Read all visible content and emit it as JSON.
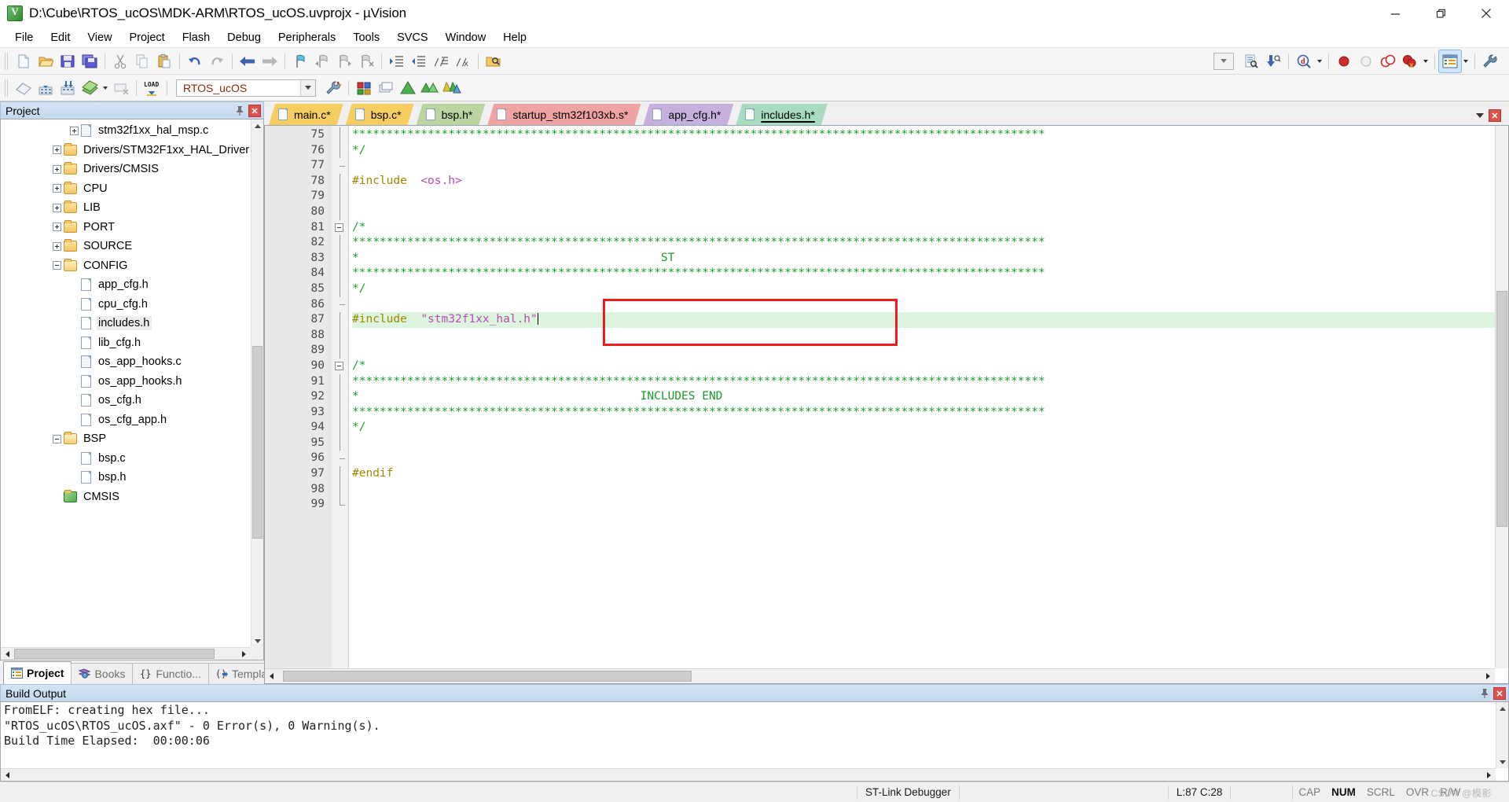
{
  "window": {
    "title": "D:\\Cube\\RTOS_ucOS\\MDK-ARM\\RTOS_ucOS.uvprojx - µVision",
    "icon": "uvision-logo",
    "minimize": "—",
    "restore": "❐",
    "close": "✕"
  },
  "menubar": {
    "items": [
      "File",
      "Edit",
      "View",
      "Project",
      "Flash",
      "Debug",
      "Peripherals",
      "Tools",
      "SVCS",
      "Window",
      "Help"
    ]
  },
  "toolbar_main": {
    "buttons": [
      {
        "name": "new-file-icon",
        "glyph": "🗋"
      },
      {
        "name": "open-file-icon",
        "glyph": "📂"
      },
      {
        "name": "save-icon",
        "glyph": "💾"
      },
      {
        "name": "save-all-icon",
        "glyph": "🖫"
      },
      {
        "name": "cut-icon",
        "glyph": "✂"
      },
      {
        "name": "copy-icon",
        "glyph": "❐"
      },
      {
        "name": "paste-icon",
        "glyph": "📋"
      },
      {
        "name": "undo-icon",
        "glyph": "↶"
      },
      {
        "name": "redo-icon",
        "glyph": "↷"
      },
      {
        "name": "navigate-back-icon",
        "glyph": "←"
      },
      {
        "name": "navigate-forward-icon",
        "glyph": "→"
      },
      {
        "name": "toggle-bookmark-icon",
        "glyph": "⚑"
      },
      {
        "name": "prev-bookmark-icon",
        "glyph": "⚑"
      },
      {
        "name": "next-bookmark-icon",
        "glyph": "⚑"
      },
      {
        "name": "clear-bookmarks-icon",
        "glyph": "⚑"
      },
      {
        "name": "indent-icon",
        "glyph": "⇥"
      },
      {
        "name": "outdent-icon",
        "glyph": "⇤"
      },
      {
        "name": "comment-icon",
        "glyph": "//"
      },
      {
        "name": "uncomment-icon",
        "glyph": "//"
      },
      {
        "name": "find-in-files-icon",
        "glyph": "🔍"
      }
    ],
    "search_combo_placeholder": "",
    "right_buttons": [
      {
        "name": "find-icon",
        "glyph": "🗂"
      },
      {
        "name": "incremental-find-icon",
        "glyph": "🔎"
      },
      {
        "name": "browse-symbol-icon",
        "glyph": "ⓘ"
      },
      {
        "name": "insert-breakpoint-icon",
        "glyph": "●"
      },
      {
        "name": "disable-breakpoint-icon",
        "glyph": "○"
      },
      {
        "name": "disable-all-breakpoints-icon",
        "glyph": "◌"
      },
      {
        "name": "kill-all-breakpoints-icon",
        "glyph": "✖"
      },
      {
        "name": "project-window-icon",
        "glyph": "▤"
      },
      {
        "name": "configuration-wizard-icon",
        "glyph": "🔧"
      }
    ]
  },
  "toolbar_build": {
    "buttons": [
      {
        "name": "translate-icon",
        "glyph": "▦"
      },
      {
        "name": "build-icon",
        "glyph": "▦"
      },
      {
        "name": "rebuild-icon",
        "glyph": "▦"
      },
      {
        "name": "batch-build-icon",
        "glyph": "▤"
      },
      {
        "name": "stop-build-icon",
        "glyph": "▧"
      },
      {
        "name": "download-icon",
        "glyph": "LOAD"
      }
    ],
    "project_target": "RTOS_ucOS",
    "right_buttons": [
      {
        "name": "target-options-icon",
        "glyph": "⚙"
      },
      {
        "name": "manage-project-items-icon",
        "glyph": "▩"
      },
      {
        "name": "manage-run-time-env-icon",
        "glyph": "◈"
      },
      {
        "name": "pack-installer-icon",
        "glyph": "◆"
      },
      {
        "name": "manage-components-icon",
        "glyph": "▲"
      }
    ]
  },
  "project_pane": {
    "title": "Project",
    "pin_icon": "pin-icon",
    "close_icon": "close-icon",
    "tree": [
      {
        "label": "stm32f1xx_hal_msp.c",
        "type": "file-src",
        "indent": 3,
        "expander": "plus",
        "selected": false
      },
      {
        "label": "Drivers/STM32F1xx_HAL_Driver",
        "type": "folder",
        "indent": 2,
        "expander": "plus",
        "selected": false
      },
      {
        "label": "Drivers/CMSIS",
        "type": "folder",
        "indent": 2,
        "expander": "plus",
        "selected": false
      },
      {
        "label": "CPU",
        "type": "folder",
        "indent": 2,
        "expander": "plus",
        "selected": false
      },
      {
        "label": "LIB",
        "type": "folder",
        "indent": 2,
        "expander": "plus",
        "selected": false
      },
      {
        "label": "PORT",
        "type": "folder",
        "indent": 2,
        "expander": "plus",
        "selected": false
      },
      {
        "label": "SOURCE",
        "type": "folder",
        "indent": 2,
        "expander": "plus",
        "selected": false
      },
      {
        "label": "CONFIG",
        "type": "folder-open",
        "indent": 2,
        "expander": "minus",
        "selected": false
      },
      {
        "label": "app_cfg.h",
        "type": "file",
        "indent": 3,
        "expander": "none",
        "selected": false
      },
      {
        "label": "cpu_cfg.h",
        "type": "file",
        "indent": 3,
        "expander": "none",
        "selected": false
      },
      {
        "label": "includes.h",
        "type": "file",
        "indent": 3,
        "expander": "none",
        "selected": true
      },
      {
        "label": "lib_cfg.h",
        "type": "file",
        "indent": 3,
        "expander": "none",
        "selected": false
      },
      {
        "label": "os_app_hooks.c",
        "type": "file-src",
        "indent": 3,
        "expander": "none",
        "selected": false
      },
      {
        "label": "os_app_hooks.h",
        "type": "file",
        "indent": 3,
        "expander": "none",
        "selected": false
      },
      {
        "label": "os_cfg.h",
        "type": "file",
        "indent": 3,
        "expander": "none",
        "selected": false
      },
      {
        "label": "os_cfg_app.h",
        "type": "file",
        "indent": 3,
        "expander": "none",
        "selected": false
      },
      {
        "label": "BSP",
        "type": "folder-open",
        "indent": 2,
        "expander": "minus",
        "selected": false
      },
      {
        "label": "bsp.c",
        "type": "file",
        "indent": 3,
        "expander": "none",
        "selected": false
      },
      {
        "label": "bsp.h",
        "type": "file",
        "indent": 3,
        "expander": "none",
        "selected": false
      },
      {
        "label": "CMSIS",
        "type": "component",
        "indent": 2,
        "expander": "none",
        "selected": false
      }
    ],
    "tabs": [
      {
        "label": "Project",
        "icon": "project-icon",
        "active": true
      },
      {
        "label": "Books",
        "icon": "books-icon",
        "active": false
      },
      {
        "label": "Functio...",
        "icon": "functions-icon",
        "active": false
      },
      {
        "label": "Templa...",
        "icon": "templates-icon",
        "active": false
      }
    ]
  },
  "editor": {
    "tabs": [
      {
        "label": "main.c*",
        "color": "#f6cd61",
        "active": false
      },
      {
        "label": "bsp.c*",
        "color": "#f6cd61",
        "active": false
      },
      {
        "label": "bsp.h*",
        "color": "#bcd4a1",
        "active": false
      },
      {
        "label": "startup_stm32f103xb.s*",
        "color": "#f0a3a3",
        "active": false
      },
      {
        "label": "app_cfg.h*",
        "color": "#c5b0de",
        "active": false
      },
      {
        "label": "includes.h*",
        "color": "#a8dcc0",
        "active": true
      }
    ],
    "dropdown_icon": "chevron-down-icon",
    "close_icon": "close-icon",
    "first_line_number": 75,
    "lines": [
      {
        "n": 75,
        "fold": "bar",
        "segments": [
          {
            "t": "*****************************************************************************************************",
            "c": "green"
          }
        ]
      },
      {
        "n": 76,
        "fold": "bar",
        "segments": [
          {
            "t": "*/",
            "c": "green"
          }
        ]
      },
      {
        "n": 77,
        "fold": "dash",
        "segments": []
      },
      {
        "n": 78,
        "fold": "bar",
        "segments": [
          {
            "t": "#include",
            "c": "keyword"
          },
          {
            "t": "  ",
            "c": "plain"
          },
          {
            "t": "<os.h>",
            "c": "string"
          }
        ]
      },
      {
        "n": 79,
        "fold": "bar",
        "segments": []
      },
      {
        "n": 80,
        "fold": "bar",
        "segments": []
      },
      {
        "n": 81,
        "fold": "box",
        "segments": [
          {
            "t": "/*",
            "c": "green"
          }
        ]
      },
      {
        "n": 82,
        "fold": "bar",
        "segments": [
          {
            "t": "*****************************************************************************************************",
            "c": "green"
          }
        ]
      },
      {
        "n": 83,
        "fold": "bar",
        "segments": [
          {
            "t": "*                                            ST",
            "c": "green"
          }
        ]
      },
      {
        "n": 84,
        "fold": "bar",
        "segments": [
          {
            "t": "*****************************************************************************************************",
            "c": "green"
          }
        ]
      },
      {
        "n": 85,
        "fold": "bar",
        "segments": [
          {
            "t": "*/",
            "c": "green"
          }
        ]
      },
      {
        "n": 86,
        "fold": "dash",
        "segments": []
      },
      {
        "n": 87,
        "fold": "bar",
        "highlight": true,
        "caret": true,
        "segments": [
          {
            "t": "#include",
            "c": "keyword"
          },
          {
            "t": "  ",
            "c": "plain"
          },
          {
            "t": "\"stm32f1xx_hal.h\"",
            "c": "string"
          }
        ]
      },
      {
        "n": 88,
        "fold": "bar",
        "segments": []
      },
      {
        "n": 89,
        "fold": "bar",
        "segments": []
      },
      {
        "n": 90,
        "fold": "box",
        "segments": [
          {
            "t": "/*",
            "c": "green"
          }
        ]
      },
      {
        "n": 91,
        "fold": "bar",
        "segments": [
          {
            "t": "*****************************************************************************************************",
            "c": "green"
          }
        ]
      },
      {
        "n": 92,
        "fold": "bar",
        "segments": [
          {
            "t": "*                                         INCLUDES END",
            "c": "green"
          }
        ]
      },
      {
        "n": 93,
        "fold": "bar",
        "segments": [
          {
            "t": "*****************************************************************************************************",
            "c": "green"
          }
        ]
      },
      {
        "n": 94,
        "fold": "bar",
        "segments": [
          {
            "t": "*/",
            "c": "green"
          }
        ]
      },
      {
        "n": 95,
        "fold": "bar",
        "segments": []
      },
      {
        "n": 96,
        "fold": "dash",
        "segments": []
      },
      {
        "n": 97,
        "fold": "bar",
        "segments": [
          {
            "t": "#endif",
            "c": "keyword"
          }
        ]
      },
      {
        "n": 98,
        "fold": "bar",
        "segments": []
      },
      {
        "n": 99,
        "fold": "end",
        "segments": []
      }
    ],
    "annotation": {
      "name": "red-highlight-box",
      "color": "#ee1c1c"
    }
  },
  "build_output": {
    "title": "Build Output",
    "pin_icon": "pin-icon",
    "close_icon": "close-icon",
    "lines": [
      "FromELF: creating hex file...",
      "\"RTOS_ucOS\\RTOS_ucOS.axf\" - 0 Error(s), 0 Warning(s).",
      "Build Time Elapsed:  00:00:06"
    ]
  },
  "statusbar": {
    "debugger": "ST-Link Debugger",
    "position": "L:87 C:28",
    "flags": [
      {
        "label": "CAP",
        "on": false
      },
      {
        "label": "NUM",
        "on": true
      },
      {
        "label": "SCRL",
        "on": false
      },
      {
        "label": "OVR",
        "on": false
      },
      {
        "label": "R/W",
        "on": false
      }
    ],
    "watermark": "CSDN @模影"
  }
}
